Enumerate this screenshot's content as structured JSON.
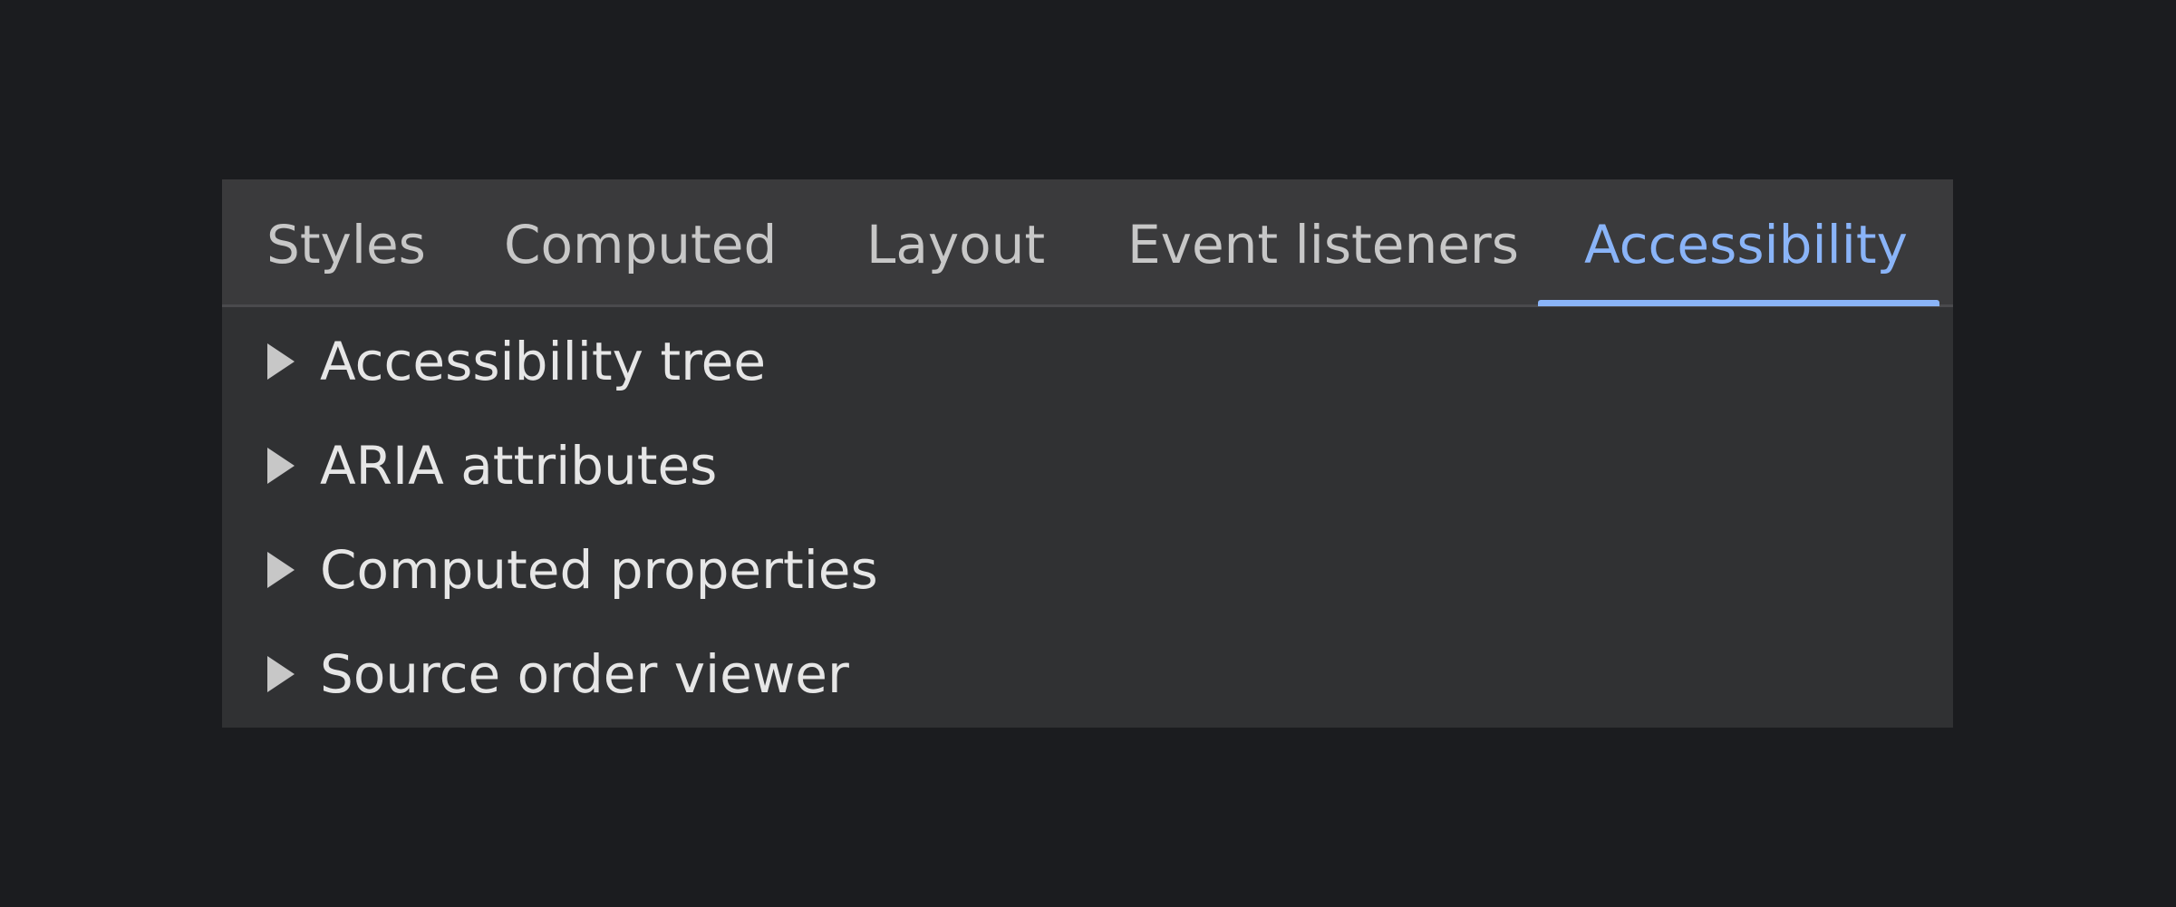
{
  "tabs": [
    {
      "label": "Styles",
      "active": false
    },
    {
      "label": "Computed",
      "active": false
    },
    {
      "label": "Layout",
      "active": false
    },
    {
      "label": "Event listeners",
      "active": false
    },
    {
      "label": "Accessibility",
      "active": true
    }
  ],
  "sections": [
    {
      "label": "Accessibility tree",
      "expanded": false
    },
    {
      "label": "ARIA attributes",
      "expanded": false
    },
    {
      "label": "Computed properties",
      "expanded": false
    },
    {
      "label": "Source order viewer",
      "expanded": false
    }
  ],
  "colors": {
    "page_background": "#1b1c1f",
    "panel_background": "#303133",
    "tabbar_background": "#3a3a3c",
    "active_tab": "#8ab4f8",
    "tab_text": "#c7c7c7",
    "row_text": "#e6e6e6"
  },
  "icons": {
    "section_toggle": "triangle-right-icon"
  }
}
